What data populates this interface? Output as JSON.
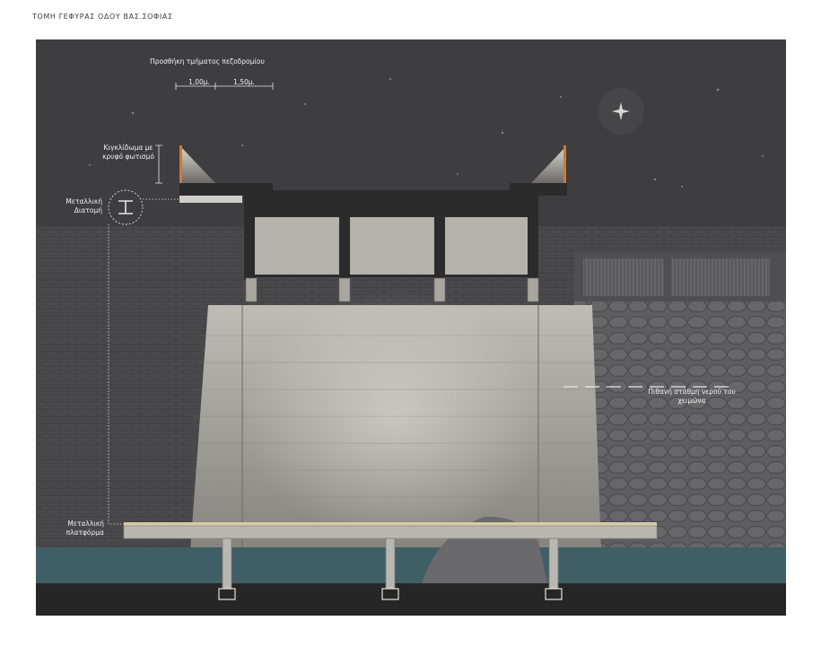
{
  "title": "ΤΟΜΗ ΓΕΦΥΡΑΣ ΟΔΟΥ ΒΑΣ.ΣΟΦΙΑΣ",
  "annotations": {
    "sidewalk_addition": "Προσθήκη τμήματος πεζοδρομίου",
    "dim_1": "1,00μ.",
    "dim_2": "1,50μ.",
    "railing": "Κιγκλίδωμα με κρυφό φωτισμό",
    "beam": "Μεταλλική Διατομή",
    "water_level": "Πιθανή στάθμη νερού του χειμώνα",
    "platform": "Μεταλλική πλατφόρμα"
  },
  "colors": {
    "sky": "#3e3d3f",
    "concrete": "#8f8d88",
    "deck": "#2b2b2c",
    "water": "#3f5e66",
    "ground": "#262627",
    "light": "#d07a30"
  }
}
